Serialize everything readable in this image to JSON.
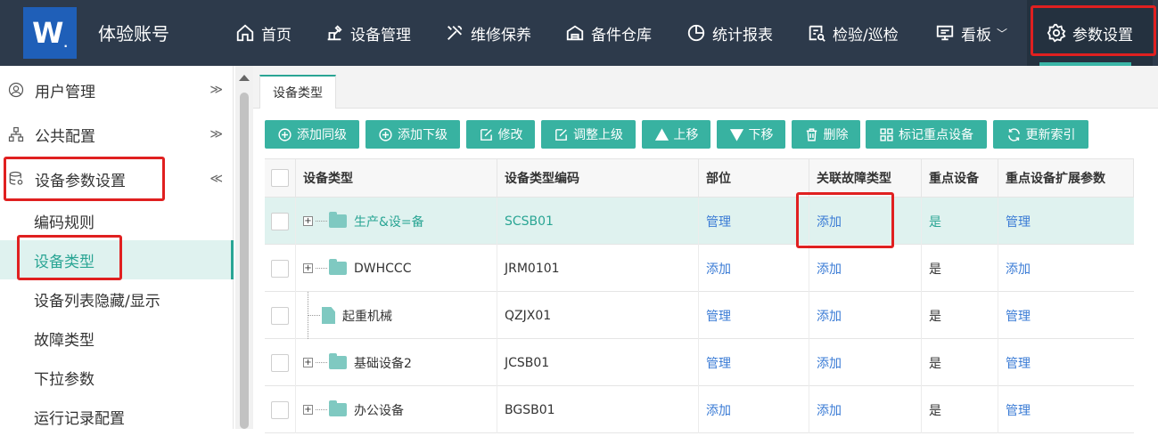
{
  "app": {
    "logo_text": "W",
    "account": "体验账号"
  },
  "nav": [
    {
      "label": "首页",
      "icon": "home-icon"
    },
    {
      "label": "设备管理",
      "icon": "machine-icon"
    },
    {
      "label": "维修保养",
      "icon": "tools-icon"
    },
    {
      "label": "备件仓库",
      "icon": "warehouse-icon"
    },
    {
      "label": "统计报表",
      "icon": "pie-chart-icon"
    },
    {
      "label": "检验/巡检",
      "icon": "inspection-icon"
    },
    {
      "label": "看板",
      "icon": "board-icon",
      "caret": "﹀"
    },
    {
      "label": "参数设置",
      "icon": "gear-icon",
      "active": true
    }
  ],
  "sidebar": {
    "groups": [
      {
        "label": "用户管理",
        "icon": "user-circle-icon",
        "chevron": "≫"
      },
      {
        "label": "公共配置",
        "icon": "hierarchy-icon",
        "chevron": "≫"
      },
      {
        "label": "设备参数设置",
        "icon": "database-icon",
        "chevron": "≪"
      }
    ],
    "items": [
      {
        "label": "编码规则"
      },
      {
        "label": "设备类型",
        "active": true
      },
      {
        "label": "设备列表隐藏/显示"
      },
      {
        "label": "故障类型"
      },
      {
        "label": "下拉参数"
      },
      {
        "label": "运行记录配置"
      }
    ]
  },
  "tab": {
    "label": "设备类型"
  },
  "toolbar": [
    {
      "label": "添加同级",
      "icon": "plus-circle-icon"
    },
    {
      "label": "添加下级",
      "icon": "plus-circle-icon"
    },
    {
      "label": "修改",
      "icon": "edit-icon"
    },
    {
      "label": "调整上级",
      "icon": "edit-icon"
    },
    {
      "label": "上移",
      "icon": "arrow-up-icon"
    },
    {
      "label": "下移",
      "icon": "arrow-down-icon"
    },
    {
      "label": "删除",
      "icon": "trash-icon"
    },
    {
      "label": "标记重点设备",
      "icon": "grid-icon"
    },
    {
      "label": "更新索引",
      "icon": "refresh-icon"
    }
  ],
  "table": {
    "headers": [
      "设备类型",
      "设备类型编码",
      "部位",
      "关联故障类型",
      "重点设备",
      "重点设备扩展参数"
    ],
    "rows": [
      {
        "type": "生产&设=备",
        "code": "SCSB01",
        "part": "管理",
        "fault": "添加",
        "key": "是",
        "ext": "管理",
        "node": "folder",
        "selected": true
      },
      {
        "type": "DWHCCC",
        "code": "JRM0101",
        "part": "添加",
        "fault": "添加",
        "key": "是",
        "ext": "添加",
        "node": "folder"
      },
      {
        "type": "起重机械",
        "code": "QZJX01",
        "part": "管理",
        "fault": "添加",
        "key": "是",
        "ext": "管理",
        "node": "file"
      },
      {
        "type": "基础设备2",
        "code": "JCSB01",
        "part": "管理",
        "fault": "添加",
        "key": "是",
        "ext": "管理",
        "node": "folder"
      },
      {
        "type": "办公设备",
        "code": "BGSB01",
        "part": "添加",
        "fault": "添加",
        "key": "是",
        "ext": "管理",
        "node": "folder"
      }
    ]
  },
  "colors": {
    "topbar": "#2d3a4b",
    "accent": "#38b2a1",
    "link": "#3a7bd5",
    "highlight": "#e02020"
  }
}
